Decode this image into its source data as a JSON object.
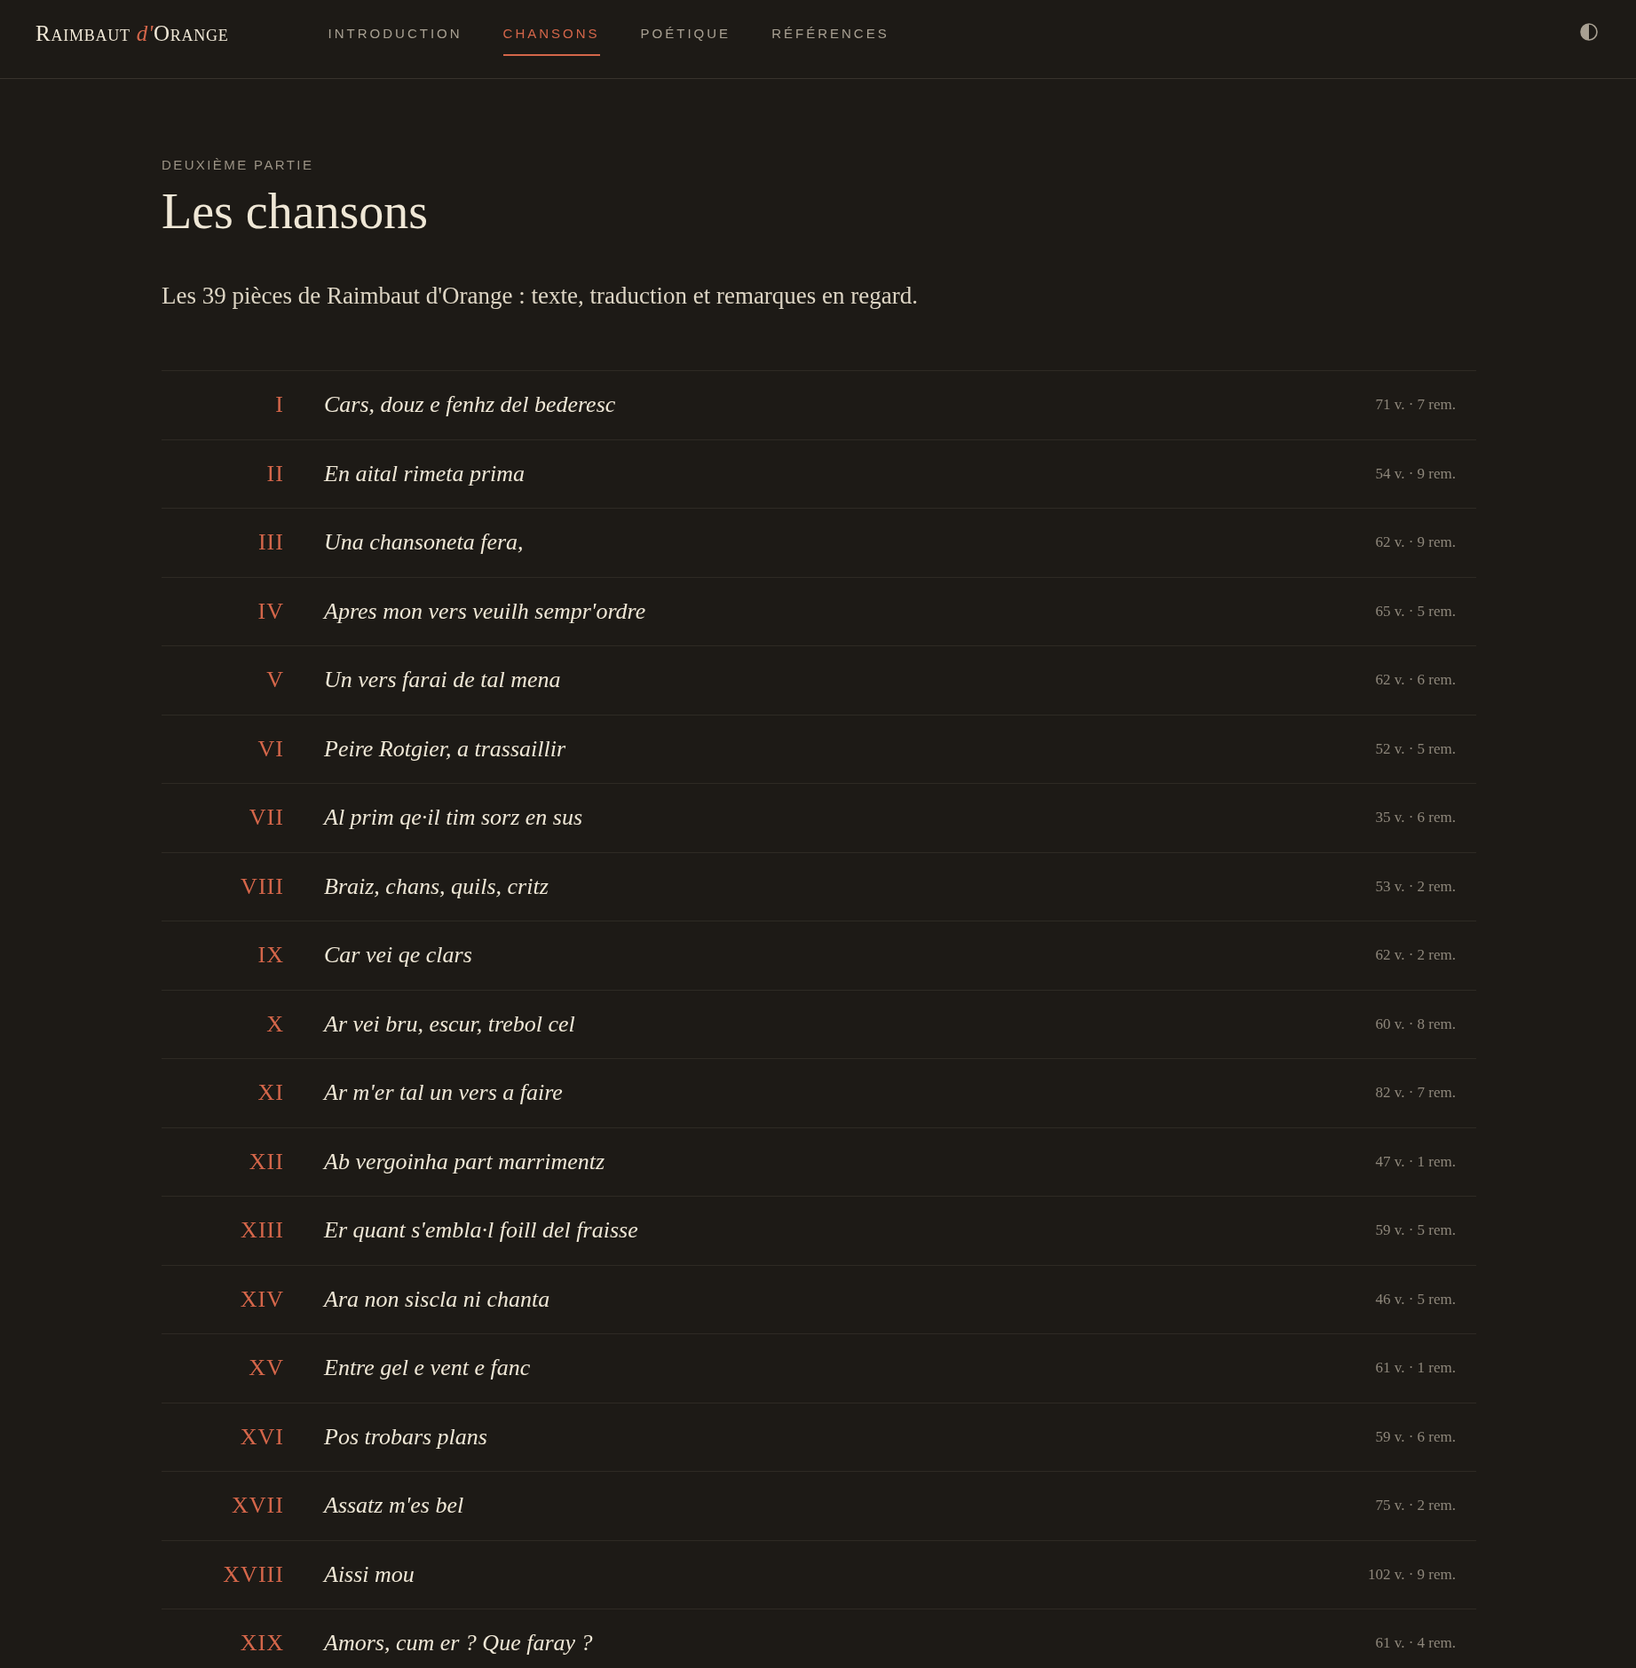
{
  "header": {
    "logo": {
      "name": "Raimbaut",
      "particle": "d'",
      "place": "Orange"
    },
    "nav": [
      {
        "label": "INTRODUCTION",
        "selected": false
      },
      {
        "label": "CHANSONS",
        "selected": true
      },
      {
        "label": "POÉTIQUE",
        "selected": false
      },
      {
        "label": "RÉFÉRENCES",
        "selected": false
      }
    ]
  },
  "page": {
    "eyebrow": "DEUXIÈME PARTIE",
    "title": "Les chansons",
    "intro": "Les 39 pièces de Raimbaut d'Orange : texte, traduction et remarques en regard."
  },
  "songs": [
    {
      "numeral": "I",
      "title": "Cars, douz e fenhz del bederesc",
      "stats": "71 v. · 7 rem."
    },
    {
      "numeral": "II",
      "title": "En aital rimeta prima",
      "stats": "54 v. · 9 rem."
    },
    {
      "numeral": "III",
      "title": "Una chansoneta fera,",
      "stats": "62 v. · 9 rem."
    },
    {
      "numeral": "IV",
      "title": "Apres mon vers veuilh sempr'ordre",
      "stats": "65 v. · 5 rem."
    },
    {
      "numeral": "V",
      "title": "Un vers farai de tal mena",
      "stats": "62 v. · 6 rem."
    },
    {
      "numeral": "VI",
      "title": "Peire Rotgier, a trassaillir",
      "stats": "52 v. · 5 rem."
    },
    {
      "numeral": "VII",
      "title": "Al prim qe·il tim sorz en sus",
      "stats": "35 v. · 6 rem."
    },
    {
      "numeral": "VIII",
      "title": "Braiz, chans, quils, critz",
      "stats": "53 v. · 2 rem."
    },
    {
      "numeral": "IX",
      "title": "Car vei qe clars",
      "stats": "62 v. · 2 rem."
    },
    {
      "numeral": "X",
      "title": "Ar vei bru, escur, trebol cel",
      "stats": "60 v. · 8 rem."
    },
    {
      "numeral": "XI",
      "title": "Ar m'er tal un vers a faire",
      "stats": "82 v. · 7 rem."
    },
    {
      "numeral": "XII",
      "title": "Ab vergoinha part marrimentz",
      "stats": "47 v. · 1 rem."
    },
    {
      "numeral": "XIII",
      "title": "Er quant s'embla·l foill del fraisse",
      "stats": "59 v. · 5 rem."
    },
    {
      "numeral": "XIV",
      "title": "Ara non siscla ni chanta",
      "stats": "46 v. · 5 rem."
    },
    {
      "numeral": "XV",
      "title": "Entre gel e vent e fanc",
      "stats": "61 v. · 1 rem."
    },
    {
      "numeral": "XVI",
      "title": "Pos trobars plans",
      "stats": "59 v. · 6 rem."
    },
    {
      "numeral": "XVII",
      "title": "Assatz m'es bel",
      "stats": "75 v. · 2 rem."
    },
    {
      "numeral": "XVIII",
      "title": "Aissi mou",
      "stats": "102 v. · 9 rem."
    },
    {
      "numeral": "XIX",
      "title": "Amors, cum er ? Que faray ?",
      "stats": "61 v. · 4 rem."
    }
  ]
}
